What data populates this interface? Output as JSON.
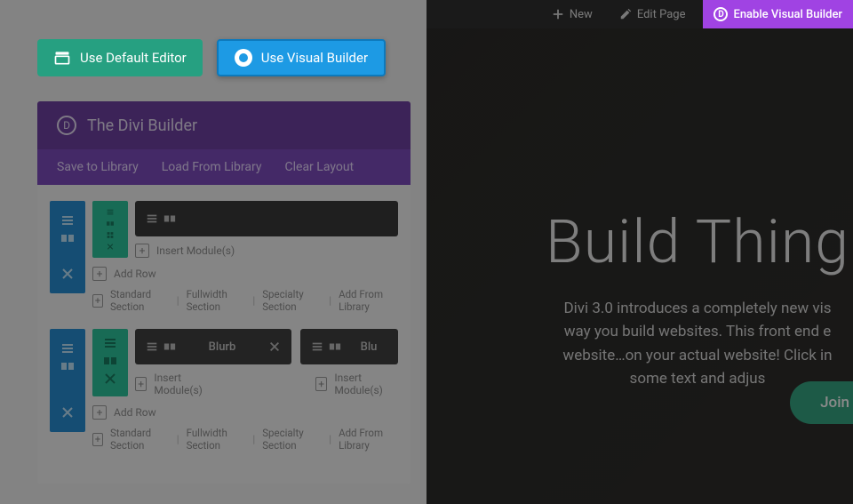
{
  "topbar": {
    "new": "New",
    "edit": "Edit Page",
    "enable": "Enable Visual Builder"
  },
  "hero": {
    "title": "Build Thing",
    "l1": "Divi 3.0 introduces a completely new vis",
    "l2": "way you build websites. This front end e",
    "l3": "website…on your actual website! Click in",
    "l4": "some text and adjus",
    "join": "Join"
  },
  "buttons": {
    "default": "Use Default Editor",
    "visual": "Use Visual Builder"
  },
  "builder": {
    "title": "The Divi Builder",
    "save": "Save to Library",
    "load": "Load From Library",
    "clear": "Clear Layout",
    "insert": "Insert Module(s)",
    "addrow": "Add Row",
    "blurb": "Blurb",
    "blu": "Blu",
    "footer": {
      "std": "Standard Section",
      "full": "Fullwidth Section",
      "spec": "Specialty Section",
      "lib": "Add From Library"
    }
  }
}
